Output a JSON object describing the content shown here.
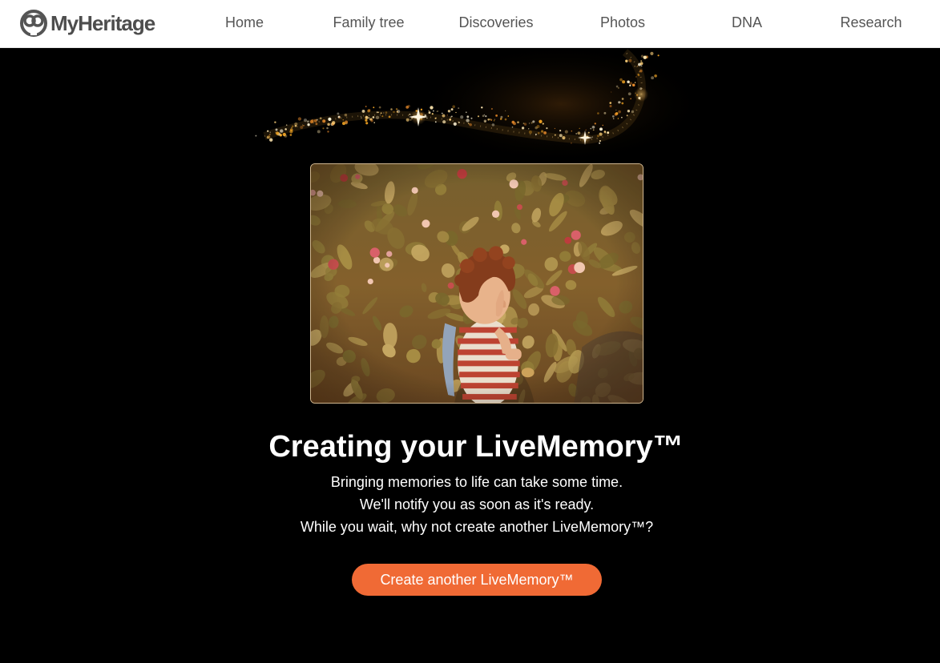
{
  "brand": {
    "name": "MyHeritage",
    "logo_icon": "myheritage-logo-icon",
    "text_color": "#4d4d4d"
  },
  "nav": {
    "items": [
      {
        "label": "Home"
      },
      {
        "label": "Family tree"
      },
      {
        "label": "Discoveries"
      },
      {
        "label": "Photos"
      },
      {
        "label": "DNA"
      },
      {
        "label": "Research"
      }
    ]
  },
  "main": {
    "title": "Creating your LiveMemory™",
    "lines": [
      "Bringing memories to life can take some time.",
      "We'll notify you as soon as it's ready.",
      "While you wait, why not create another LiveMemory™?"
    ],
    "cta_label": "Create another LiveMemory™",
    "photo_subject": "vintage-photo-child-in-garden",
    "decoration": "sparkle-trail"
  },
  "colors": {
    "background": "#000000",
    "accent": "#f06a35",
    "nav_bg": "#ffffff",
    "nav_text": "#555555",
    "sparkle": "#f5a623"
  }
}
